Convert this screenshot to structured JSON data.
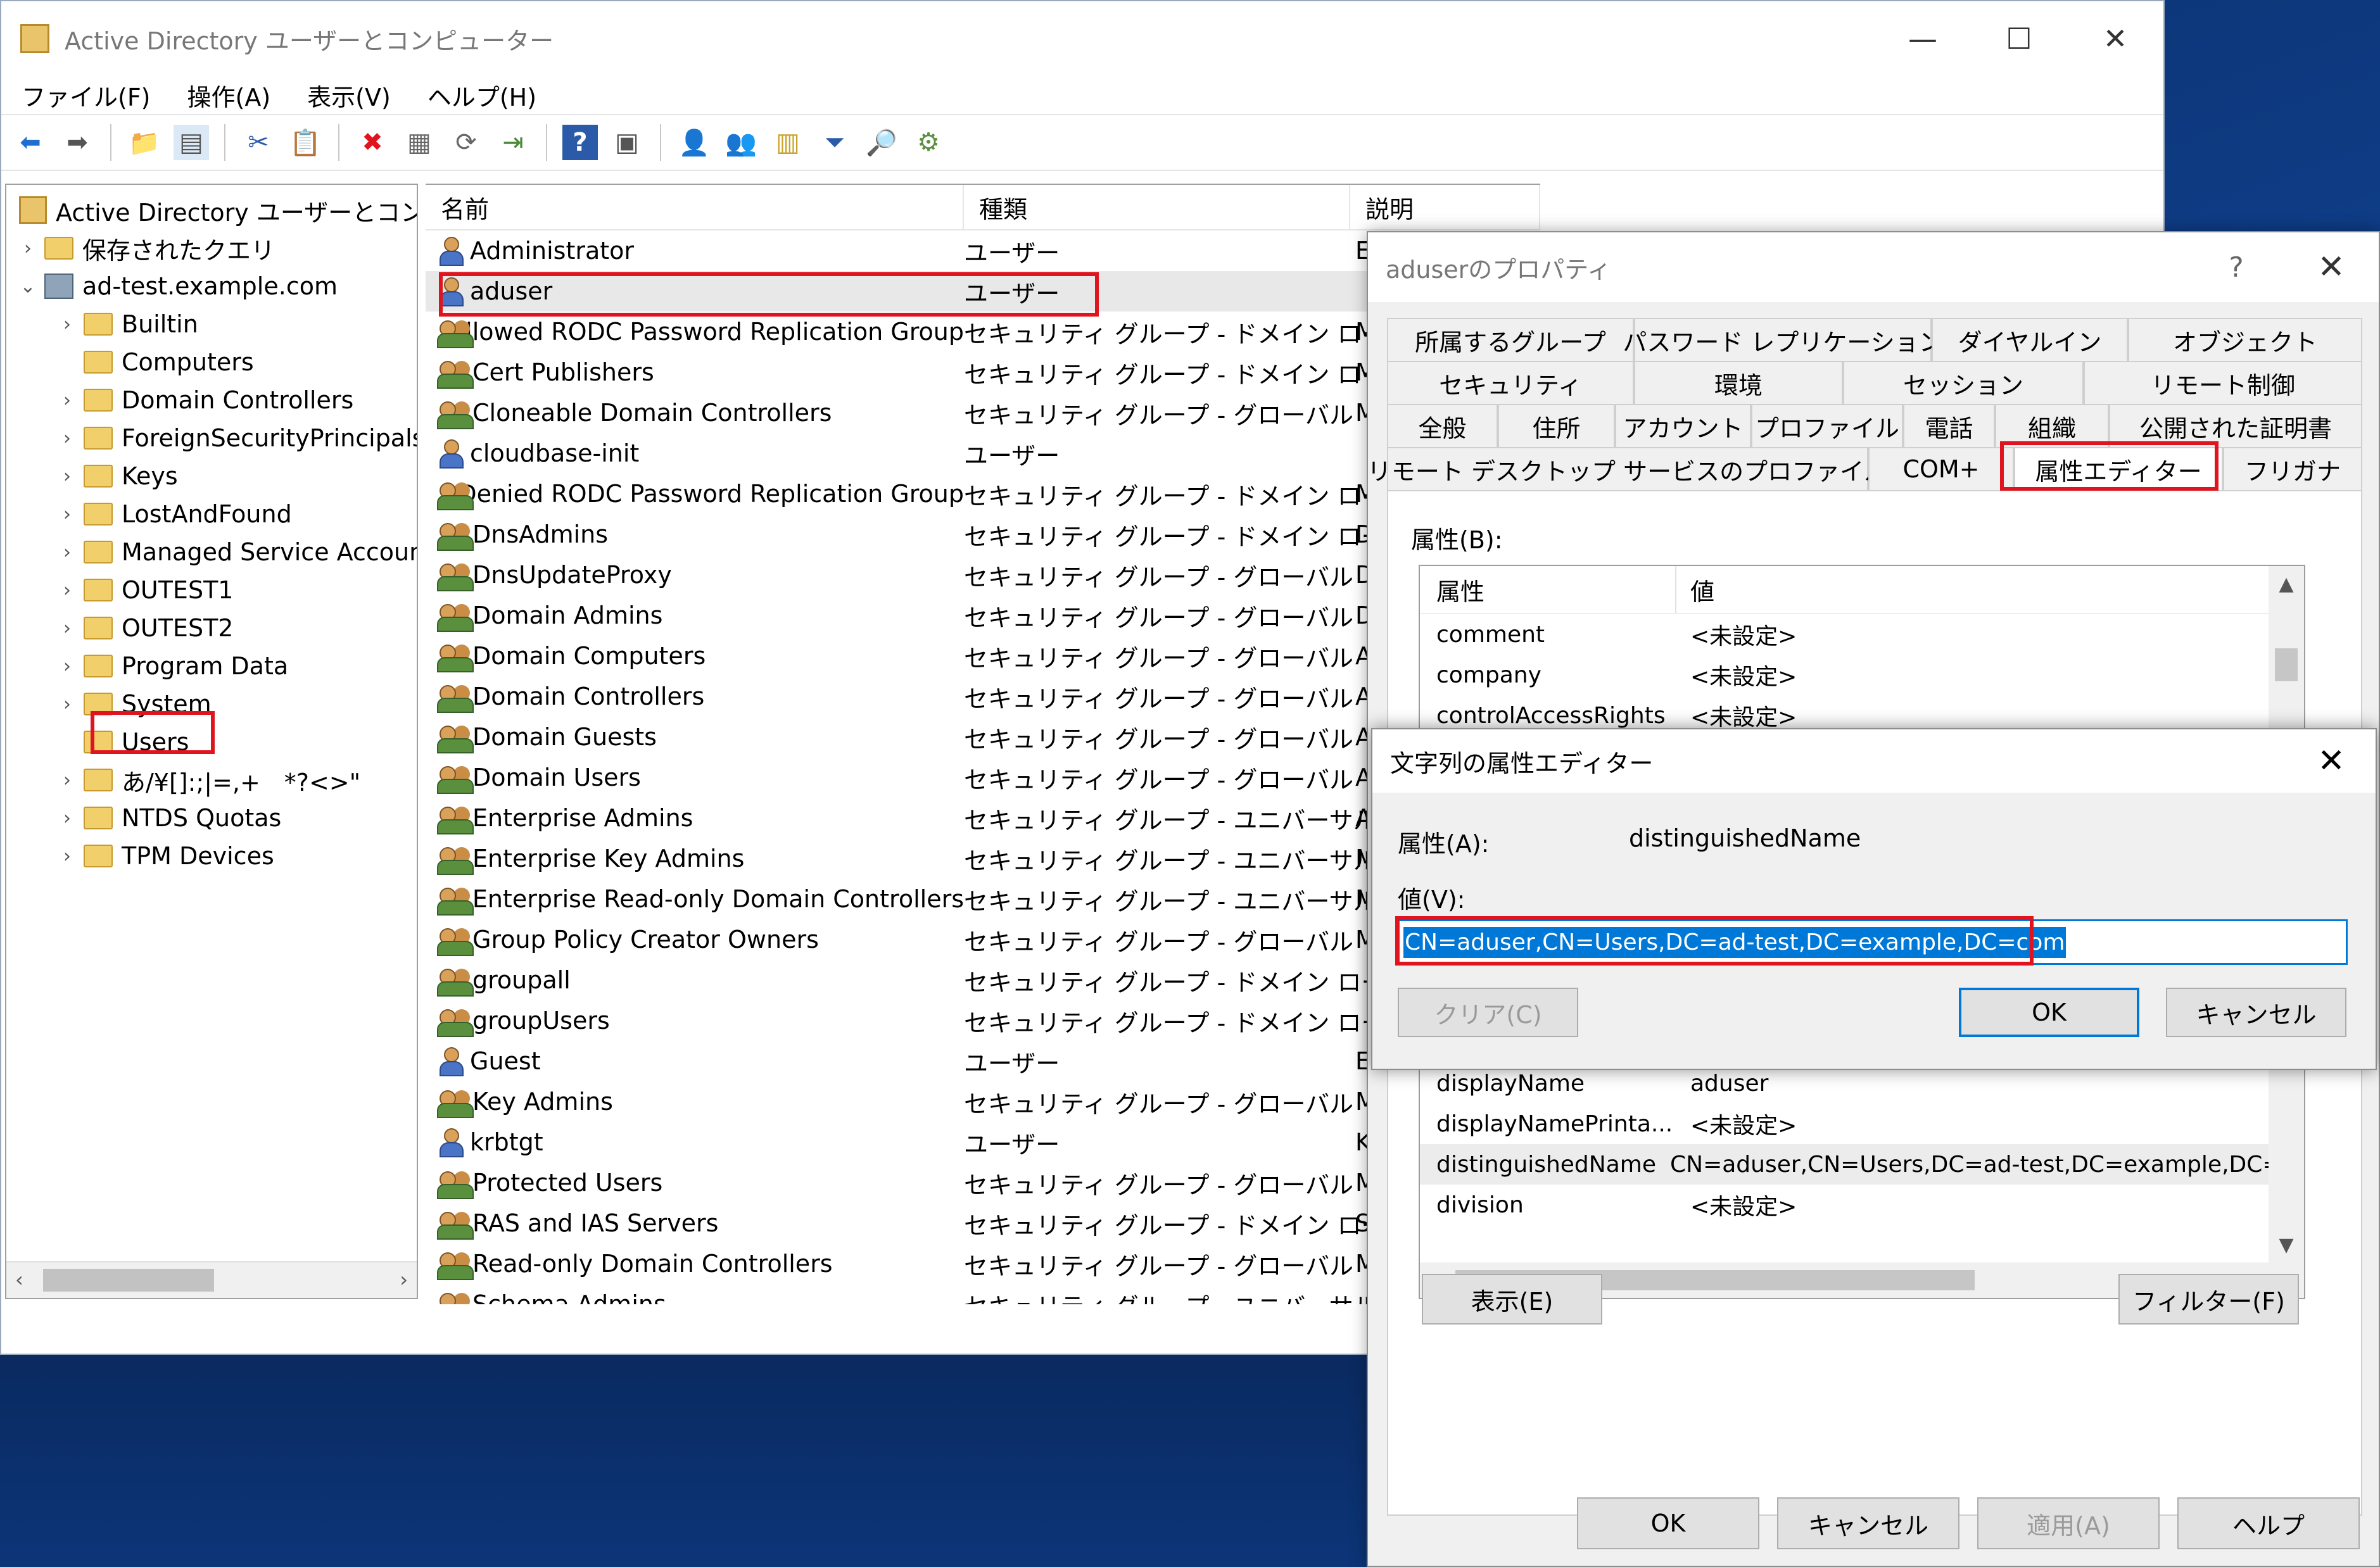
{
  "window": {
    "title": "Active Directory ユーザーとコンピューター",
    "minimize": "—",
    "maximize": "☐",
    "close": "✕"
  },
  "menu": [
    "ファイル(F)",
    "操作(A)",
    "表示(V)",
    "ヘルプ(H)"
  ],
  "tree": {
    "root": "Active Directory ユーザーとコンピュー",
    "saved_queries": "保存されたクエリ",
    "domain": "ad-test.example.com",
    "items": [
      "Builtin",
      "Computers",
      "Domain Controllers",
      "ForeignSecurityPrincipals",
      "Keys",
      "LostAndFound",
      "Managed Service Accounts",
      "OUTEST1",
      "OUTEST2",
      "Program Data",
      "System",
      "Users",
      "あ/¥[]:;|=,+　*?<>\"",
      "NTDS Quotas",
      "TPM Devices"
    ]
  },
  "list": {
    "columns": [
      "名前",
      "種類",
      "説明"
    ],
    "rows": [
      {
        "name": "Administrator",
        "type": "ユーザー",
        "kind": "user",
        "desc": "E"
      },
      {
        "name": "aduser",
        "type": "ユーザー",
        "kind": "user",
        "desc": ""
      },
      {
        "name": "Allowed RODC Password Replication Group",
        "type": "セキュリティ グループ - ドメイン ロー...",
        "kind": "group",
        "desc": "M"
      },
      {
        "name": "Cert Publishers",
        "type": "セキュリティ グループ - ドメイン ロー...",
        "kind": "group",
        "desc": "M"
      },
      {
        "name": "Cloneable Domain Controllers",
        "type": "セキュリティ グループ - グローバル",
        "kind": "group",
        "desc": "M"
      },
      {
        "name": "cloudbase-init",
        "type": "ユーザー",
        "kind": "user",
        "desc": ""
      },
      {
        "name": "Denied RODC Password Replication Group",
        "type": "セキュリティ グループ - ドメイン ロー...",
        "kind": "group",
        "desc": "M"
      },
      {
        "name": "DnsAdmins",
        "type": "セキュリティ グループ - ドメイン ロー...",
        "kind": "group",
        "desc": "D"
      },
      {
        "name": "DnsUpdateProxy",
        "type": "セキュリティ グループ - グローバル",
        "kind": "group",
        "desc": "D"
      },
      {
        "name": "Domain Admins",
        "type": "セキュリティ グループ - グローバル",
        "kind": "group",
        "desc": "D"
      },
      {
        "name": "Domain Computers",
        "type": "セキュリティ グループ - グローバル",
        "kind": "group",
        "desc": "A"
      },
      {
        "name": "Domain Controllers",
        "type": "セキュリティ グループ - グローバル",
        "kind": "group",
        "desc": "A"
      },
      {
        "name": "Domain Guests",
        "type": "セキュリティ グループ - グローバル",
        "kind": "group",
        "desc": "A"
      },
      {
        "name": "Domain Users",
        "type": "セキュリティ グループ - グローバル",
        "kind": "group",
        "desc": "A"
      },
      {
        "name": "Enterprise Admins",
        "type": "セキュリティ グループ - ユニバーサル",
        "kind": "group",
        "desc": "A"
      },
      {
        "name": "Enterprise Key Admins",
        "type": "セキュリティ グループ - ユニバーサル",
        "kind": "group",
        "desc": "M"
      },
      {
        "name": "Enterprise Read-only Domain Controllers",
        "type": "セキュリティ グループ - ユニバーサル",
        "kind": "group",
        "desc": "M"
      },
      {
        "name": "Group Policy Creator Owners",
        "type": "セキュリティ グループ - グローバル",
        "kind": "group",
        "desc": "M"
      },
      {
        "name": "groupall",
        "type": "セキュリティ グループ - ドメイン ロー...",
        "kind": "group",
        "desc": ""
      },
      {
        "name": "groupUsers",
        "type": "セキュリティ グループ - ドメイン ロー...",
        "kind": "group",
        "desc": ""
      },
      {
        "name": "Guest",
        "type": "ユーザー",
        "kind": "user",
        "desc": "E"
      },
      {
        "name": "Key Admins",
        "type": "セキュリティ グループ - グローバル",
        "kind": "group",
        "desc": "M"
      },
      {
        "name": "krbtgt",
        "type": "ユーザー",
        "kind": "user",
        "desc": "K"
      },
      {
        "name": "Protected Users",
        "type": "セキュリティ グループ - グローバル",
        "kind": "group",
        "desc": "M"
      },
      {
        "name": "RAS and IAS Servers",
        "type": "セキュリティ グループ - ドメイン ロー...",
        "kind": "group",
        "desc": "S"
      },
      {
        "name": "Read-only Domain Controllers",
        "type": "セキュリティ グループ - グローバル",
        "kind": "group",
        "desc": "M"
      },
      {
        "name": "Schema Admins",
        "type": "セキュリティ グループ - ユニバーサル",
        "kind": "group",
        "desc": ""
      }
    ]
  },
  "properties": {
    "title": "aduserのプロパティ",
    "help": "?",
    "close": "✕",
    "tab_rows": [
      [
        "所属するグループ",
        "パスワード レプリケーション",
        "ダイヤルイン",
        "オブジェクト"
      ],
      [
        "セキュリティ",
        "環境",
        "セッション",
        "リモート制御"
      ],
      [
        "全般",
        "住所",
        "アカウント",
        "プロファイル",
        "電話",
        "組織",
        "公開された証明書"
      ],
      [
        "リモート デスクトップ サービスのプロファイル",
        "COM+",
        "属性エディター",
        "フリガナ"
      ]
    ],
    "attributes_label": "属性(B):",
    "attr_columns": [
      "属性",
      "値"
    ],
    "attrs_top": [
      {
        "k": "comment",
        "v": "<未設定>"
      },
      {
        "k": "company",
        "v": "<未設定>"
      },
      {
        "k": "controlAccessRights",
        "v": "<未設定>"
      }
    ],
    "attrs_bottom": [
      {
        "k": "displayName",
        "v": "aduser"
      },
      {
        "k": "displayNamePrinta...",
        "v": "<未設定>"
      },
      {
        "k": "distinguishedName",
        "v": "CN=aduser,CN=Users,DC=ad-test,DC=example,DC=com"
      },
      {
        "k": "division",
        "v": "<未設定>"
      }
    ],
    "view_button": "表示(E)",
    "filter_button": "フィルター(F)",
    "ok": "OK",
    "cancel": "キャンセル",
    "apply": "適用(A)",
    "help_button": "ヘルプ"
  },
  "string_editor": {
    "title": "文字列の属性エディター",
    "close": "✕",
    "attr_label": "属性(A):",
    "attr_name": "distinguishedName",
    "value_label": "値(V):",
    "value": "CN=aduser,CN=Users,DC=ad-test,DC=example,DC=com",
    "clear": "クリア(C)",
    "ok": "OK",
    "cancel": "キャンセル"
  }
}
